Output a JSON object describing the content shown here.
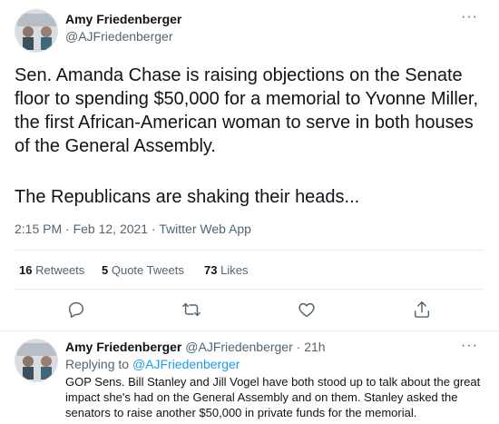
{
  "tweet": {
    "author_name": "Amy Friedenberger",
    "author_handle": "@AJFriedenberger",
    "body_line1": "Sen. Amanda Chase is raising objections on the Senate floor to spending $50,000 for a memorial to Yvonne Miller, the first African-American woman to serve in both houses of the General Assembly.",
    "body_line2": "The Republicans are shaking their heads...",
    "timestamp": "2:15 PM · Feb 12, 2021 · Twitter Web App",
    "more_icon": "more-icon",
    "stats": {
      "retweets_count": "16",
      "retweets_label": "Retweets",
      "quotes_count": "5",
      "quotes_label": "Quote Tweets",
      "likes_count": "73",
      "likes_label": "Likes"
    }
  },
  "actions": {
    "reply_icon": "reply-icon",
    "retweet_icon": "retweet-icon",
    "like_icon": "heart-icon",
    "share_icon": "share-icon"
  },
  "reply": {
    "author_name": "Amy Friedenberger",
    "author_handle": "@AJFriedenberger",
    "age": "· 21h",
    "replying_prefix": "Replying to",
    "replying_to": "@AJFriedenberger",
    "body": "GOP Sens. Bill Stanley and Jill Vogel have both stood up to talk about the great impact she's had on the General Assembly and on them. Stanley asked the senators to raise another $50,000 in private funds for the memorial.",
    "more_icon": "more-icon"
  },
  "colors": {
    "text": "#0f1419",
    "secondary": "#536471",
    "link": "#1d9bf0",
    "divider": "#e6ecf0"
  }
}
